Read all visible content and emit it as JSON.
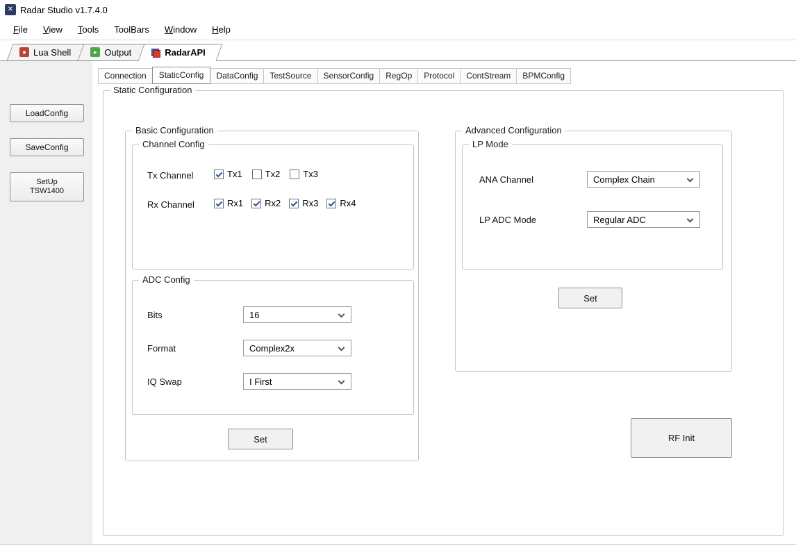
{
  "window": {
    "title": "Radar Studio v1.7.4.0"
  },
  "menu": {
    "items": [
      {
        "accel": "F",
        "rest": "ile"
      },
      {
        "accel": "V",
        "rest": "iew"
      },
      {
        "accel": "T",
        "rest": "ools"
      },
      {
        "accel": "",
        "rest": "ToolBars"
      },
      {
        "accel": "W",
        "rest": "indow"
      },
      {
        "accel": "H",
        "rest": "elp"
      }
    ]
  },
  "icons": {
    "app_glyph": "✕",
    "lua_glyph": "●",
    "output_glyph": "▸"
  },
  "shell_tabs": {
    "lua_shell": "Lua Shell",
    "output": "Output",
    "radar_api": "RadarAPI",
    "active": "RadarAPI"
  },
  "sidebar": {
    "load_config": "LoadConfig",
    "save_config": "SaveConfig",
    "setup_line1": "SetUp",
    "setup_line2": "TSW1400"
  },
  "api_tabs": {
    "items": [
      "Connection",
      "StaticConfig",
      "DataConfig",
      "TestSource",
      "SensorConfig",
      "RegOp",
      "Protocol",
      "ContStream",
      "BPMConfig"
    ],
    "active": "StaticConfig"
  },
  "static_config": {
    "title": "Static Configuration",
    "basic": {
      "title": "Basic Configuration",
      "channel": {
        "title": "Channel Config",
        "tx_label": "Tx Channel",
        "tx": [
          {
            "label": "Tx1",
            "checked": true
          },
          {
            "label": "Tx2",
            "checked": false
          },
          {
            "label": "Tx3",
            "checked": false
          }
        ],
        "rx_label": "Rx Channel",
        "rx": [
          {
            "label": "Rx1",
            "checked": true
          },
          {
            "label": "Rx2",
            "checked": true
          },
          {
            "label": "Rx3",
            "checked": true
          },
          {
            "label": "Rx4",
            "checked": true
          }
        ]
      },
      "adc": {
        "title": "ADC Config",
        "bits_label": "Bits",
        "bits_value": "16",
        "format_label": "Format",
        "format_value": "Complex2x",
        "iqswap_label": "IQ Swap",
        "iqswap_value": "I First"
      },
      "set_label": "Set"
    },
    "advanced": {
      "title": "Advanced Configuration",
      "lp": {
        "title": "LP Mode",
        "ana_label": "ANA Channel",
        "ana_value": "Complex Chain",
        "lpadc_label": "LP ADC Mode",
        "lpadc_value": "Regular ADC"
      },
      "set_label": "Set"
    },
    "rf_init_label": "RF Init"
  },
  "colors": {
    "check_accent": "#2b579a",
    "sidebar_bg": "#f0f0f0",
    "lua_icon": "#b8453a",
    "output_icon": "#4ea64b",
    "api_icon_blue": "#3a62b0",
    "api_icon_red": "#d23b2f"
  }
}
